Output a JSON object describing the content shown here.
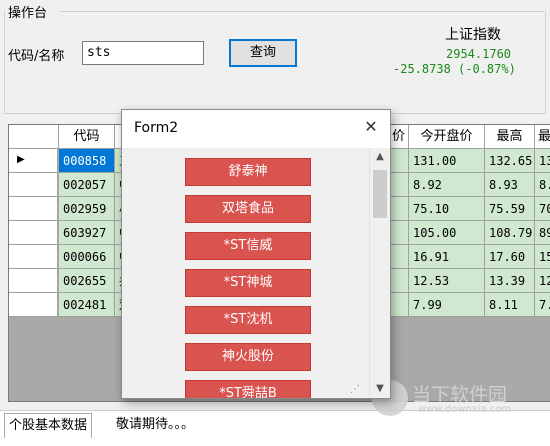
{
  "panel": {
    "title": "操作台",
    "code_label": "代码/名称",
    "code_value": "sts",
    "query_button": "查询",
    "index_title": "上证指数",
    "index_value": "2954.1760",
    "index_change": "-25.8738 (-0.87%)"
  },
  "grid": {
    "headers": [
      "代码",
      "",
      "价",
      "今开盘价",
      "最高",
      "最"
    ],
    "rows": [
      {
        "code": "000858",
        "name": "五",
        "open": "131.00",
        "high": "132.65",
        "more": "13"
      },
      {
        "code": "002057",
        "name": "中",
        "open": "8.92",
        "high": "8.93",
        "more": "8."
      },
      {
        "code": "002959",
        "name": "小",
        "open": "75.10",
        "high": "75.59",
        "more": "70"
      },
      {
        "code": "603927",
        "name": "中",
        "open": "105.00",
        "high": "108.79",
        "more": "89"
      },
      {
        "code": "000066",
        "name": "中",
        "open": "16.91",
        "high": "17.60",
        "more": "15"
      },
      {
        "code": "002655",
        "name": "共",
        "open": "12.53",
        "high": "13.39",
        "more": "12"
      },
      {
        "code": "002481",
        "name": "双",
        "open": "7.99",
        "high": "8.11",
        "more": "7."
      }
    ],
    "current_row_marker": "▶"
  },
  "form2": {
    "title": "Form2",
    "close": "✕",
    "buttons": [
      "舒泰神",
      "双塔食品",
      "*ST信威",
      "*ST神城",
      "*ST沈机",
      "神火股份",
      "*ST舜喆B"
    ]
  },
  "tabs": [
    "个股基本数据",
    "敬请期待。。。"
  ],
  "watermark": {
    "text": "当下软件园",
    "url": "www.downxia.com"
  },
  "colors": {
    "grid_cell": "#cfe8cf",
    "selected": "#0078d7",
    "stock_button": "#d9534f",
    "index": "#1a8a1a"
  }
}
